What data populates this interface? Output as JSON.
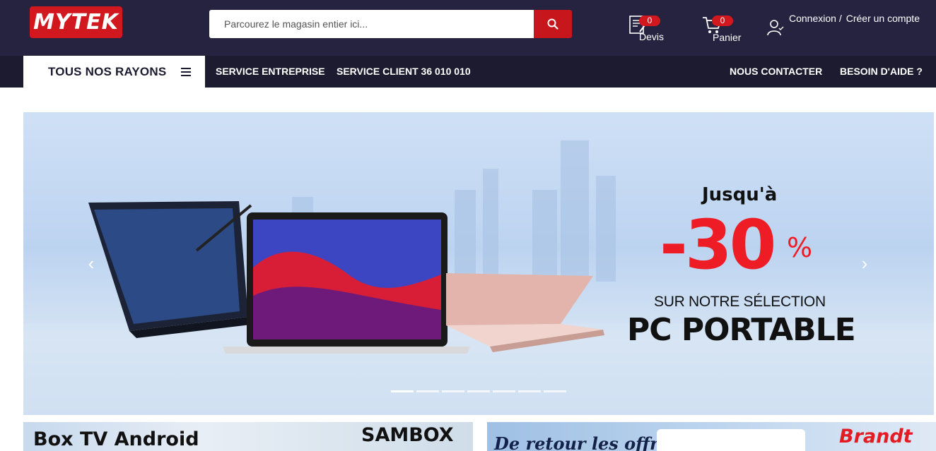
{
  "header": {
    "logo_text": "MYTEK",
    "search_placeholder": "Parcourez le magasin entier ici...",
    "devis": {
      "label": "Devis",
      "count": "0"
    },
    "panier": {
      "label": "Panier",
      "count": "0"
    },
    "account": {
      "login": "Connexion /",
      "register": "Créer un compte"
    }
  },
  "nav": {
    "rayons_label": "TOUS NOS RAYONS",
    "links": [
      "SERVICE ENTREPRISE",
      "SERVICE CLIENT 36 010 010"
    ],
    "right_links": [
      "NOUS CONTACTER",
      "BESOIN D'AIDE ?"
    ]
  },
  "hero": {
    "line1": "Jusqu'à",
    "discount": "-30",
    "percent": "%",
    "line3": "SUR NOTRE SÉLECTION",
    "line4": "PC PORTABLE",
    "prev_icon": "‹",
    "next_icon": "›",
    "slide_count": 7,
    "active_slide": 1
  },
  "banners": {
    "left_title": "Box TV Android",
    "left_brand": "SAMBOX",
    "right_title": "De retour les offres!",
    "right_brand": "Brandt"
  },
  "colors": {
    "header_bg": "#25233f",
    "nav_bg": "#1c1b2f",
    "accent_red": "#d1181f"
  }
}
